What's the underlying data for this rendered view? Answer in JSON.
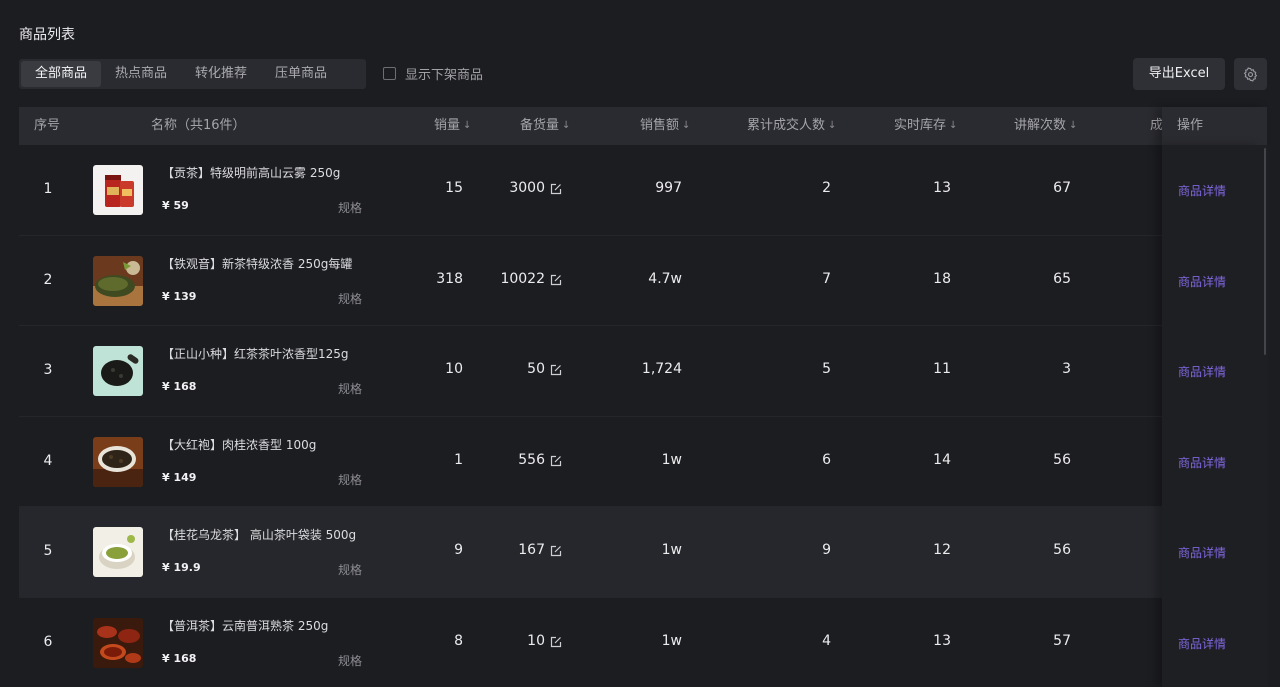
{
  "page": {
    "title": "商品列表"
  },
  "tabs": [
    {
      "label": "全部商品",
      "active": true
    },
    {
      "label": "热点商品",
      "active": false
    },
    {
      "label": "转化推荐",
      "active": false
    },
    {
      "label": "压单商品",
      "active": false
    }
  ],
  "filter": {
    "show_offshelf_label": "显示下架商品",
    "checked": false
  },
  "toolbar": {
    "export_label": "导出Excel",
    "settings_icon": "gear-icon"
  },
  "table": {
    "columns": {
      "index": "序号",
      "name": "名称（共16件）",
      "sales": "销量",
      "prep_stock": "备货量",
      "amount": "销售额",
      "buyers": "累计成交人数",
      "inventory": "实时库存",
      "explain": "讲解次数",
      "overflow": "成",
      "action": "操作"
    },
    "sort_indicator": "↓",
    "rows": [
      {
        "index": "1",
        "name": "【贡茶】特级明前高山云雾 250g",
        "price": "¥ 59",
        "spec": "规格",
        "sales": "15",
        "prep_stock": "3000",
        "amount": "997",
        "buyers": "2",
        "inventory": "13",
        "explain": "67",
        "action": "商品详情",
        "thumb": "tea-can"
      },
      {
        "index": "2",
        "name": "【铁观音】新茶特级浓香 250g每罐",
        "price": "¥ 139",
        "spec": "规格",
        "sales": "318",
        "prep_stock": "10022",
        "amount": "4.7w",
        "buyers": "7",
        "inventory": "18",
        "explain": "65",
        "action": "商品详情",
        "thumb": "tea-leaves"
      },
      {
        "index": "3",
        "name": "【正山小种】红茶茶叶浓香型125g",
        "price": "¥ 168",
        "spec": "规格",
        "sales": "10",
        "prep_stock": "50",
        "amount": "1,724",
        "buyers": "5",
        "inventory": "11",
        "explain": "3",
        "action": "商品详情",
        "thumb": "black-tea-spoon"
      },
      {
        "index": "4",
        "name": "【大红袍】肉桂浓香型 100g",
        "price": "¥ 149",
        "spec": "规格",
        "sales": "1",
        "prep_stock": "556",
        "amount": "1w",
        "buyers": "6",
        "inventory": "14",
        "explain": "56",
        "action": "商品详情",
        "thumb": "oolong-cup"
      },
      {
        "index": "5",
        "name": "【桂花乌龙茶】 高山茶叶袋装 500g",
        "price": "¥ 19.9",
        "spec": "规格",
        "sales": "9",
        "prep_stock": "167",
        "amount": "1w",
        "buyers": "9",
        "inventory": "12",
        "explain": "56",
        "action": "商品详情",
        "thumb": "green-tea-cup"
      },
      {
        "index": "6",
        "name": "【普洱茶】云南普洱熟茶 250g",
        "price": "¥ 168",
        "spec": "规格",
        "sales": "8",
        "prep_stock": "10",
        "amount": "1w",
        "buyers": "4",
        "inventory": "13",
        "explain": "57",
        "action": "商品详情",
        "thumb": "puer-cups"
      }
    ]
  },
  "colors": {
    "accent": "#8067e0",
    "background": "#1c1d21",
    "header_bg": "#2a2b30"
  }
}
